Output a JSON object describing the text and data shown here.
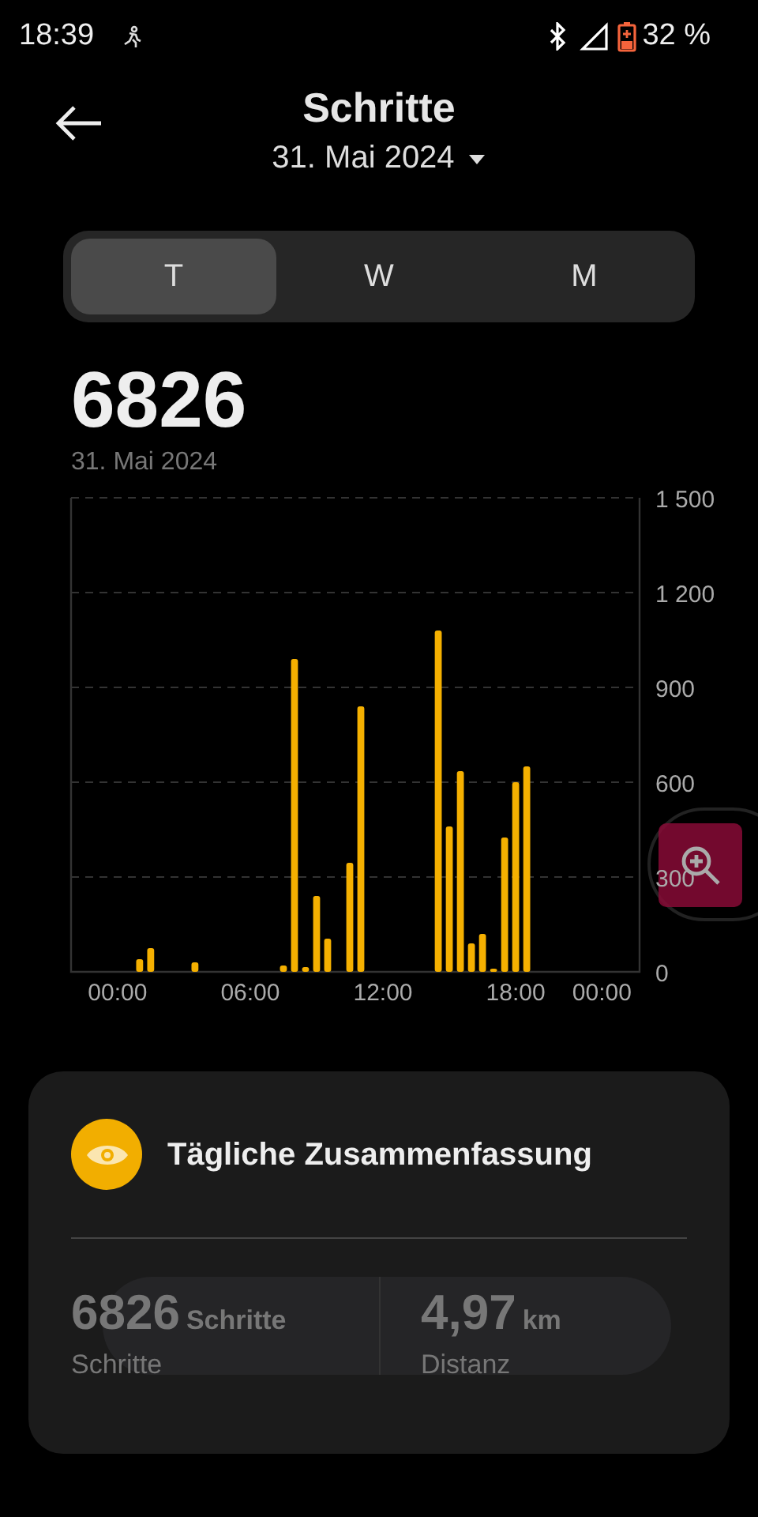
{
  "status_bar": {
    "time": "18:39",
    "battery": "32 %"
  },
  "header": {
    "title": "Schritte",
    "date": "31. Mai 2024"
  },
  "tabs": [
    {
      "label": "T",
      "selected": true
    },
    {
      "label": "W",
      "selected": false
    },
    {
      "label": "M",
      "selected": false
    }
  ],
  "total": {
    "value": "6826",
    "date": "31. Mai 2024"
  },
  "chart": {
    "chart_data": {
      "type": "bar",
      "x": [
        1,
        1.5,
        3.5,
        7.5,
        8,
        8.5,
        9,
        9.5,
        10.5,
        11,
        14.5,
        15,
        15.5,
        16,
        16.5,
        17,
        17.5,
        18,
        18.5
      ],
      "grid": true,
      "series": [
        {
          "color": "#f5b000",
          "values": [
            40,
            75,
            30,
            20,
            990,
            15,
            240,
            105,
            345,
            840,
            1080,
            460,
            635,
            90,
            120,
            10,
            425,
            600,
            650
          ]
        }
      ],
      "xlim": [
        -2.1,
        23.6
      ],
      "ylim": [
        0,
        1500
      ],
      "xticks": [
        {
          "value": 0,
          "label": "00:00"
        },
        {
          "value": 6,
          "label": "06:00"
        },
        {
          "value": 12,
          "label": "12:00"
        },
        {
          "value": 18,
          "label": "18:00"
        },
        {
          "value": 21.9,
          "label": "00:00"
        }
      ],
      "yticks": [
        {
          "value": 0,
          "label": "0"
        },
        {
          "value": 300,
          "label": "300"
        },
        {
          "value": 600,
          "label": "600"
        },
        {
          "value": 900,
          "label": "900"
        },
        {
          "value": 1200,
          "label": "1 200"
        },
        {
          "value": 1500,
          "label": "1 500"
        }
      ]
    }
  },
  "summary": {
    "title": "Tägliche Zusammenfassung",
    "stats": [
      {
        "value": "6826",
        "unit": "Schritte",
        "label": "Schritte"
      },
      {
        "value": "4,97",
        "unit": "km",
        "label": "Distanz"
      }
    ]
  }
}
